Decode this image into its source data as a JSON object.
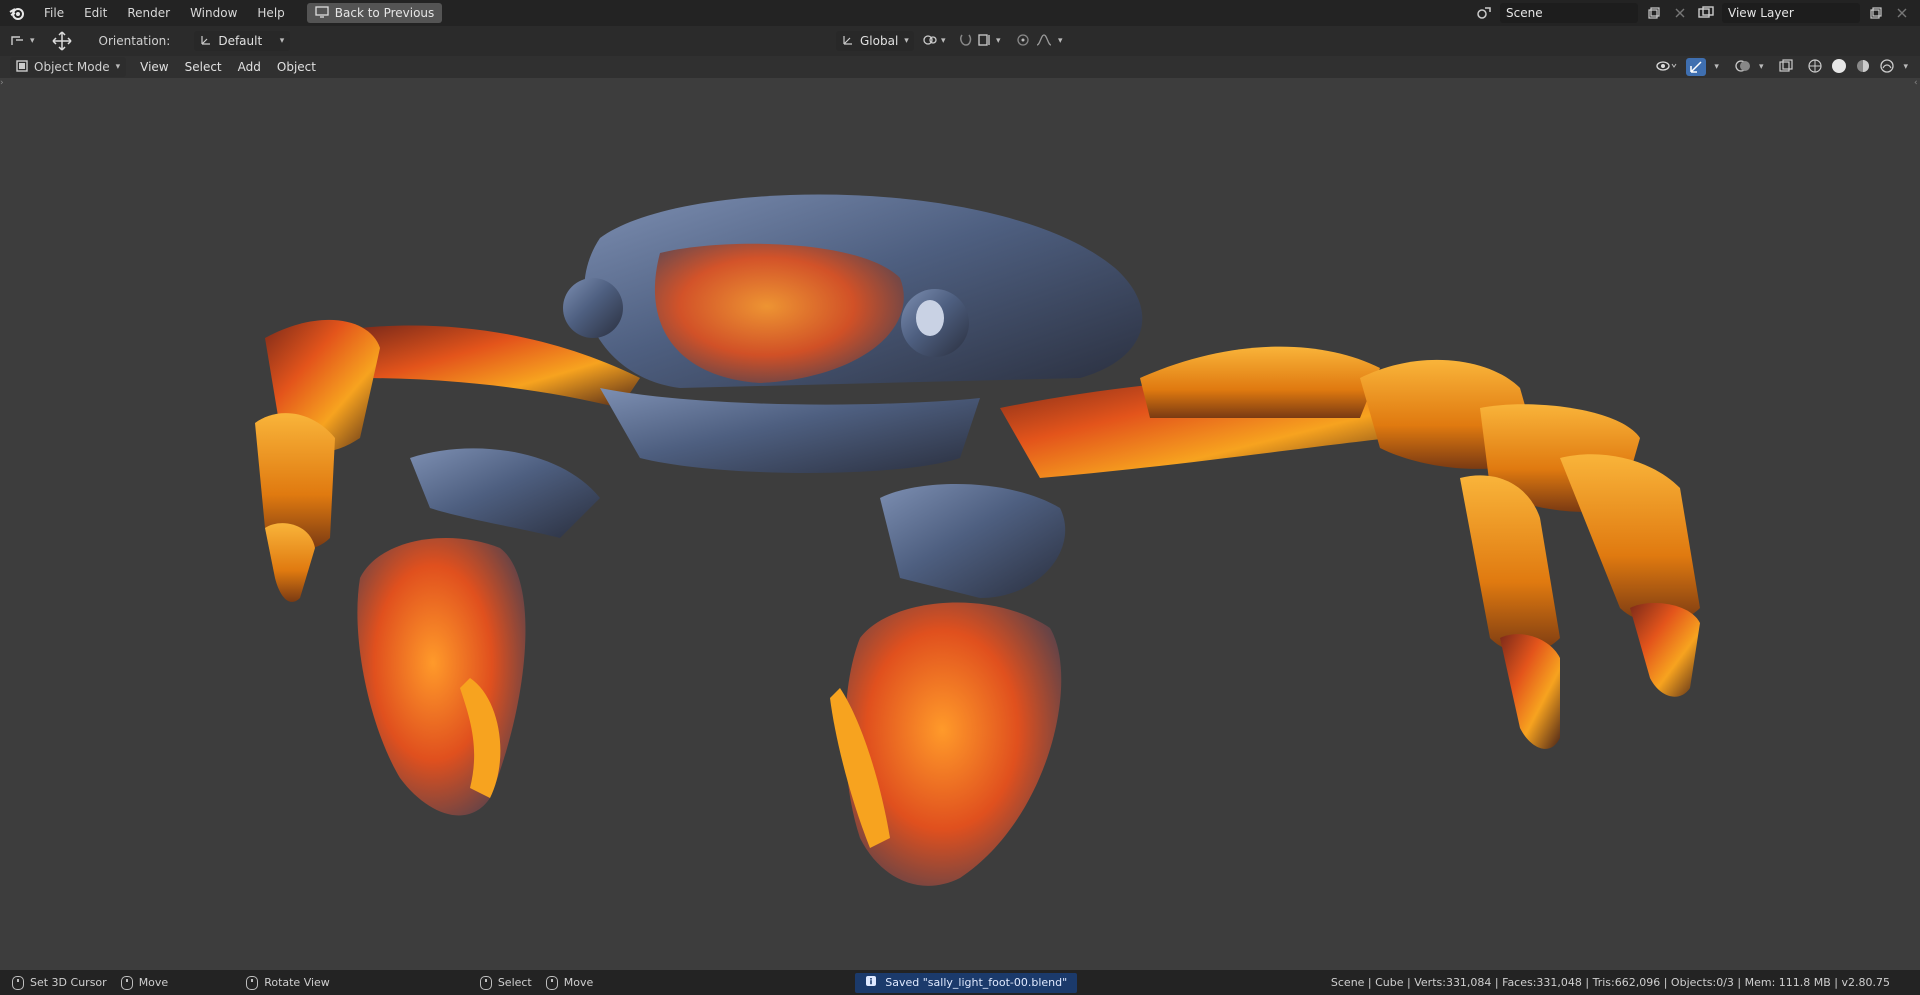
{
  "menu": {
    "items": [
      "File",
      "Edit",
      "Render",
      "Window",
      "Help"
    ],
    "back_button": "Back to Previous"
  },
  "topbar_right": {
    "scene": "Scene",
    "view_layer": "View Layer"
  },
  "tool_header": {
    "orientation_label": "Orientation:",
    "orientation_value": "Default",
    "transform_orientation": "Global"
  },
  "viewport_header": {
    "mode": "Object Mode",
    "menus": [
      "View",
      "Select",
      "Add",
      "Object"
    ]
  },
  "status_bar": {
    "left_hints": [
      "Set 3D Cursor",
      "Move",
      "Rotate View",
      "Select",
      "Move"
    ],
    "saved_message": "Saved \"sally_light_foot-00.blend\"",
    "stats": "Scene | Cube | Verts:331,084 | Faces:331,048 | Tris:662,096 | Objects:0/3 | Mem: 111.8 MB | v2.80.75"
  },
  "colors": {
    "accent_blue": "#1b3a6b",
    "viewport_bg": "#3d3d3d",
    "topbar_bg": "#232323",
    "crab_orange": "#f39a1c",
    "crab_steel": "#5a6f93"
  },
  "icons": [
    "blender-logo-icon",
    "monitor-icon",
    "transform-gizmo-icon",
    "scene-icon",
    "copy-icon",
    "close-icon",
    "view-layer-icon",
    "snap-icon",
    "proportional-icon",
    "overlay-icon",
    "xray-icon",
    "shading-solid-icon",
    "mouse-icon",
    "info-icon"
  ]
}
